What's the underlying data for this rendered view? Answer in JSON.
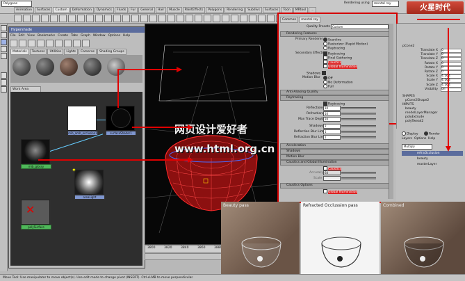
{
  "top": {
    "mode_select": "Polygons",
    "renderer_label": "Rendering using",
    "renderer_value": "mental ray",
    "watermark_logo": "火星时代"
  },
  "shelf": {
    "tabs": [
      "Animation",
      "Surfaces",
      "Custom",
      "Deformation",
      "Dynamics",
      "Fluids",
      "Fur",
      "General",
      "Hair",
      "Muscle",
      "PaintEffects",
      "Polygons",
      "Rendering",
      "Subdivs",
      "Surfaces",
      "Toon",
      "MRtool",
      "..."
    ]
  },
  "hypershade": {
    "title": "Hypershade",
    "menus": [
      "File",
      "Edit",
      "View",
      "Bookmarks",
      "Create",
      "Tabs",
      "Graph",
      "Window",
      "Options",
      "Help"
    ],
    "tabs": [
      "Materials",
      "Textures",
      "Utilities",
      "Lights",
      "Cameras",
      "Shading Groups",
      "Bake Sets",
      "Projects"
    ],
    "work_area": "Work Area",
    "nodes": {
      "white": "mib_amb_occlusion1",
      "black": "surfaceShader1",
      "glow": "mib_glossy",
      "light": "areaLight",
      "glass": "polySurface"
    }
  },
  "viewport": {
    "ruler": [
      "3800",
      "3820",
      "3840",
      "3860",
      "3880",
      "3900",
      "3920",
      "3940"
    ],
    "watermark_cn": "网页设计爱好者",
    "watermark_url": "www.html.org.cn"
  },
  "attr": {
    "tabs": [
      "Common",
      "mental ray"
    ],
    "quality_label": "Quality Presets",
    "quality_value": "Custom",
    "rendering_features": "Rendering Features",
    "primary_renderer": "Primary Renderer",
    "opt_scanline": "Scanline",
    "opt_rasterizer": "Rasterizer (Rapid Motion)",
    "opt_raytracing": "Raytracing",
    "secondary_effects": "Secondary Effects",
    "eff_raytracing": "Raytracing",
    "eff_final": "Final Gathering",
    "eff_caustics": "Caustics",
    "eff_gi": "Global Illumination",
    "shadows": "Shadows",
    "motion_blur": "Motion Blur",
    "mb_off": "Off",
    "mb_nodef": "No Deformation",
    "mb_full": "Full",
    "anti_aliasing": "Anti-Aliasing Quality",
    "raytracing": "Raytracing",
    "rt_checkbox": "Raytracing",
    "reflections": "Reflections",
    "refl_val": "10",
    "refractions": "Refractions",
    "refr_val": "10",
    "max_trace": "Max Trace Depth",
    "trace_val": "20",
    "shadows2": "Shadows",
    "shad_val": "2",
    "reflect_blur": "Reflection Blur Limit",
    "rbl_val": "1",
    "refract_blur": "Refraction Blur Limit",
    "rfbl_val": "1",
    "acceleration": "Acceleration",
    "shadows_sec": "Shadows",
    "motion_blur_sec": "Motion Blur",
    "caustics_gi": "Caustics and Global Illumination",
    "caustics_chk": "Caustics",
    "accuracy": "Accuracy",
    "accuracy_val": "64",
    "scale": "Scale",
    "caustics_options": "Caustics Options",
    "gi_chk": "Global Illumination"
  },
  "channel_box": {
    "object": "pCone2",
    "channels": [
      [
        "Translate X",
        "0"
      ],
      [
        "Translate Y",
        "0"
      ],
      [
        "Translate Z",
        "0"
      ],
      [
        "Rotate X",
        "0"
      ],
      [
        "Rotate Y",
        "0"
      ],
      [
        "Rotate Z",
        "0"
      ],
      [
        "Scale X",
        "4.164"
      ],
      [
        "Scale Y",
        "4.164"
      ],
      [
        "Scale Z",
        "4.164"
      ],
      [
        "Visibility",
        "on"
      ]
    ],
    "shapes_hdr": "SHAPES",
    "shape": "pCone2Shape2",
    "inputs_hdr": "INPUTS",
    "inputs": [
      "beauty",
      "rendelLayerManager",
      "polyExtrude",
      "polyTweak2"
    ],
    "display_radio": "Display",
    "render_radio": "Render",
    "layers_menu": [
      "Layers",
      "Options",
      "Help"
    ],
    "layer_dropdown": "Multiply",
    "layers": [
      "refraOcclusion",
      "beauty",
      "masterLayer"
    ]
  },
  "passes": {
    "beauty": "Beauty pass",
    "refracted": "Refracted Occlussion pass",
    "combined": "Combined"
  },
  "status_bar": "Move Tool: Use manipulator to move object(s). Use edit mode to change pivot (INSERT). Ctrl+LMB to move perpendicular."
}
